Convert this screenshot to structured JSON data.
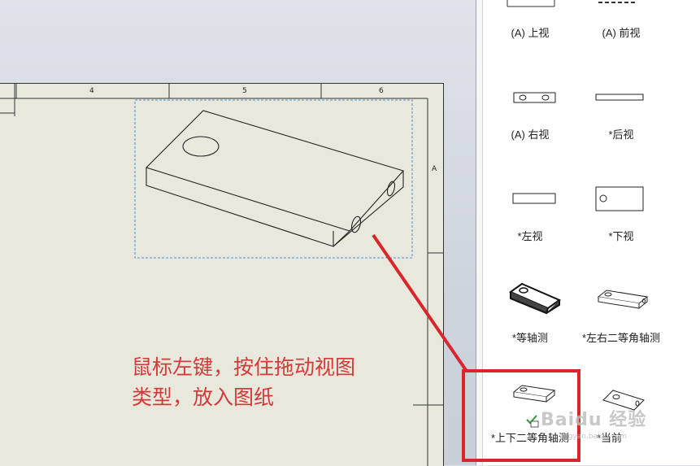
{
  "sheet": {
    "column_labels": [
      "4",
      "5",
      "6"
    ],
    "row_label": "A"
  },
  "annotation": {
    "line1": "鼠标左键，按住拖动视图",
    "line2": "类型，放入图纸"
  },
  "views": [
    {
      "label": "(A) 上视",
      "icon": "top-view-icon"
    },
    {
      "label": "(A) 前视",
      "icon": "front-view-icon"
    },
    {
      "label": "(A) 右视",
      "icon": "right-view-icon"
    },
    {
      "label": "*后视",
      "icon": "back-view-icon"
    },
    {
      "label": "*左视",
      "icon": "left-view-icon"
    },
    {
      "label": "*下视",
      "icon": "bottom-view-icon"
    },
    {
      "label": "*等轴测",
      "icon": "isometric-view-icon"
    },
    {
      "label": "*左右二等角轴测",
      "icon": "dimetric-lr-view-icon"
    },
    {
      "label": "*上下二等角轴测",
      "icon": "dimetric-tb-view-icon"
    },
    {
      "label": "*当前",
      "icon": "current-view-icon"
    }
  ],
  "watermark": {
    "brand": "Baidu 经验",
    "url": "jingyan.baidu.com"
  },
  "colors": {
    "sheet": "#e9e8dc",
    "annotation_red": "#d33a3a",
    "highlight_red": "#d9262d",
    "selection_blue": "#4a90d9"
  }
}
